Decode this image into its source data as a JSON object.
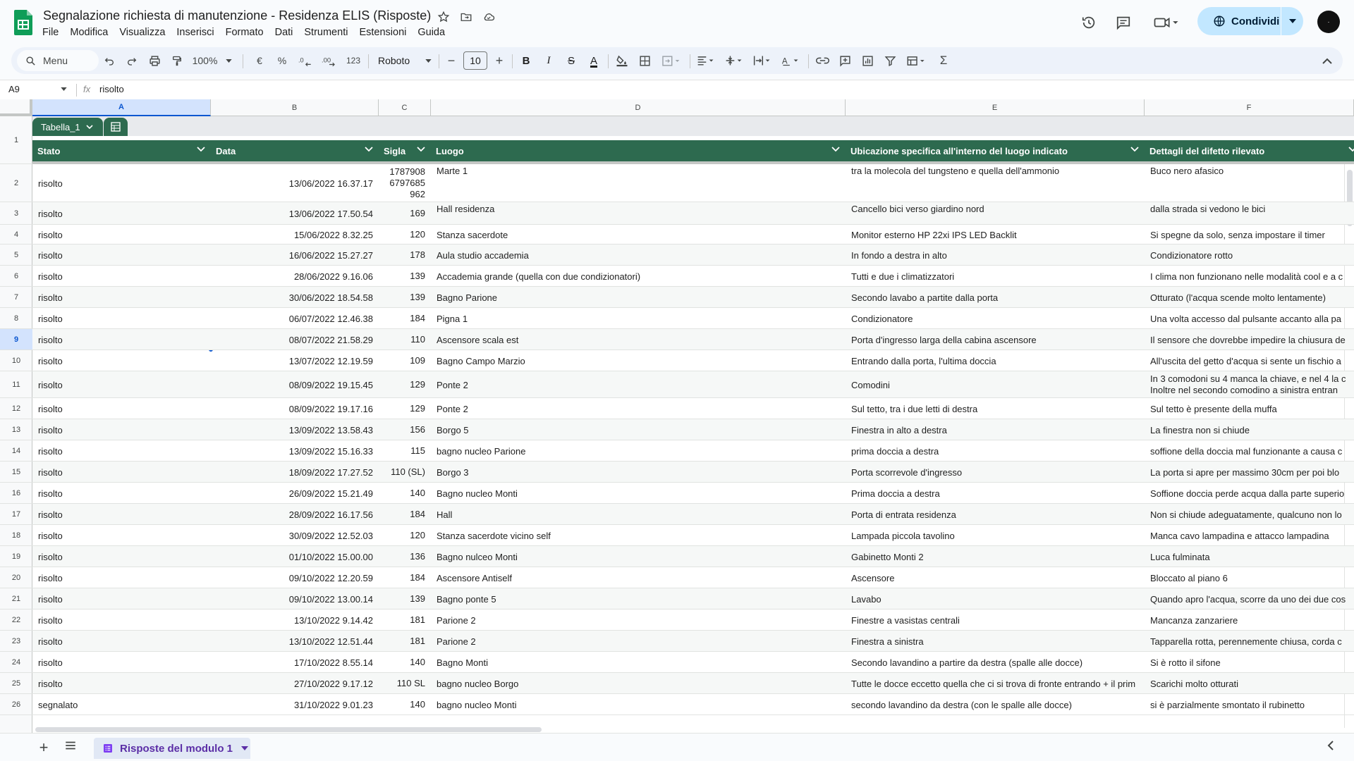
{
  "app": {
    "title": "Segnalazione richiesta di manutenzione - Residenza ELIS (Risposte)",
    "menus": [
      "File",
      "Modifica",
      "Visualizza",
      "Inserisci",
      "Formato",
      "Dati",
      "Strumenti",
      "Estensioni",
      "Guida"
    ],
    "share_label": "Condividi",
    "avatar_text": "·"
  },
  "toolbar": {
    "search_label": "Menu",
    "zoom": "100%",
    "currency": "€",
    "percent": "%",
    "dec_decrease": ".0←",
    "dec_increase": ".00",
    "number_format": "123",
    "font": "Roboto",
    "font_size": "10",
    "minus": "−",
    "plus": "+",
    "bold": "B",
    "italic": "I",
    "strike": "S",
    "text_color": "A",
    "sum": "Σ"
  },
  "formula_bar": {
    "cell_ref": "A9",
    "fx": "fx",
    "value": "risolto"
  },
  "columns": [
    "A",
    "B",
    "C",
    "D",
    "E",
    "F"
  ],
  "table": {
    "name": "Tabella_1",
    "headers": [
      "Stato",
      "Data",
      "Sigla",
      "Luogo",
      "Ubicazione specifica all'interno del luogo indicato",
      "Dettagli del difetto rilevato"
    ],
    "rows": [
      {
        "n": "2",
        "stato": "risolto",
        "data": "13/06/2022 16.37.17",
        "sigla": [
          "1787908",
          "6797685",
          "962"
        ],
        "luogo": "Marte 1",
        "ubicazione": "tra la molecola del tungsteno e quella dell'ammonio",
        "dettagli": "Buco nero afasico"
      },
      {
        "n": "3",
        "stato": "risolto",
        "data": "13/06/2022 17.50.54",
        "sigla": [
          "169"
        ],
        "luogo": "Hall residenza",
        "ubicazione": "Cancello bici verso giardino nord",
        "dettagli": "dalla strada si vedono le bici"
      },
      {
        "n": "4",
        "stato": "risolto",
        "data": "15/06/2022 8.32.25",
        "sigla": [
          "120"
        ],
        "luogo": "Stanza sacerdote",
        "ubicazione": "Monitor esterno HP 22xi IPS LED Backlit",
        "dettagli": "Si spegne da solo, senza impostare il timer"
      },
      {
        "n": "5",
        "stato": "risolto",
        "data": "16/06/2022 15.27.27",
        "sigla": [
          "178"
        ],
        "luogo": "Aula studio accademia",
        "ubicazione": "In fondo a destra in alto",
        "dettagli": "Condizionatore rotto"
      },
      {
        "n": "6",
        "stato": "risolto",
        "data": "28/06/2022 9.16.06",
        "sigla": [
          "139"
        ],
        "luogo": "Accademia grande (quella con due condizionatori)",
        "ubicazione": "Tutti e due i climatizzatori",
        "dettagli": "I clima non funzionano nelle modalità cool e a c"
      },
      {
        "n": "7",
        "stato": "risolto",
        "data": "30/06/2022 18.54.58",
        "sigla": [
          "139"
        ],
        "luogo": "Bagno Parione",
        "ubicazione": "Secondo lavabo a partite dalla porta",
        "dettagli": "Otturato (l'acqua scende molto lentamente)"
      },
      {
        "n": "8",
        "stato": "risolto",
        "data": "06/07/2022 12.46.38",
        "sigla": [
          "184"
        ],
        "luogo": "Pigna 1",
        "ubicazione": "Condizionatore",
        "dettagli": "Una volta accesso dal pulsante accanto alla pa"
      },
      {
        "n": "9",
        "stato": "risolto",
        "data": "08/07/2022 21.58.29",
        "sigla": [
          "110"
        ],
        "luogo": "Ascensore scala est",
        "ubicazione": "Porta d'ingresso larga della cabina ascensore",
        "dettagli": "Il sensore che dovrebbe impedire la chiusura de"
      },
      {
        "n": "10",
        "stato": "risolto",
        "data": "13/07/2022 12.19.59",
        "sigla": [
          "109"
        ],
        "luogo": "Bagno Campo Marzio",
        "ubicazione": "Entrando dalla porta, l'ultima doccia",
        "dettagli": "All'uscita del getto d'acqua si sente un fischio a"
      },
      {
        "n": "11",
        "stato": "risolto",
        "data": "08/09/2022 19.15.45",
        "sigla": [
          "129"
        ],
        "luogo": "Ponte 2",
        "ubicazione": "Comodini",
        "dettagli": "In 3 comodoni su 4 manca la chiave, e nel 4 la c",
        "dettagli2": "Inoltre nel secondo comodino a sinistra entran"
      },
      {
        "n": "12",
        "stato": "risolto",
        "data": "08/09/2022 19.17.16",
        "sigla": [
          "129"
        ],
        "luogo": "Ponte 2",
        "ubicazione": "Sul tetto, tra i due letti di destra",
        "dettagli": "Sul tetto è presente della muffa"
      },
      {
        "n": "13",
        "stato": "risolto",
        "data": "13/09/2022 13.58.43",
        "sigla": [
          "156"
        ],
        "luogo": "Borgo 5",
        "ubicazione": "Finestra in alto a destra",
        "dettagli": "La finestra non si chiude"
      },
      {
        "n": "14",
        "stato": "risolto",
        "data": "13/09/2022 15.16.33",
        "sigla": [
          "115"
        ],
        "luogo": "bagno nucleo Parione",
        "ubicazione": "prima doccia a destra",
        "dettagli": "soffione della doccia mal funzionante a causa c"
      },
      {
        "n": "15",
        "stato": "risolto",
        "data": "18/09/2022 17.27.52",
        "sigla": [
          "110 (SL)"
        ],
        "luogo": "Borgo 3",
        "ubicazione": "Porta scorrevole d'ingresso",
        "dettagli": "La porta si apre per massimo 30cm per poi blo"
      },
      {
        "n": "16",
        "stato": "risolto",
        "data": "26/09/2022 15.21.49",
        "sigla": [
          "140"
        ],
        "luogo": "Bagno nucleo Monti",
        "ubicazione": "Prima doccia a destra",
        "dettagli": "Soffione doccia perde acqua dalla parte superio"
      },
      {
        "n": "17",
        "stato": "risolto",
        "data": "28/09/2022 16.17.56",
        "sigla": [
          "184"
        ],
        "luogo": "Hall",
        "ubicazione": "Porta di entrata residenza",
        "dettagli": "Non si chiude adeguatamente, qualcuno non lo"
      },
      {
        "n": "18",
        "stato": "risolto",
        "data": "30/09/2022 12.52.03",
        "sigla": [
          "120"
        ],
        "luogo": "Stanza sacerdote vicino self",
        "ubicazione": "Lampada piccola tavolino",
        "dettagli": "Manca cavo lampadina e attacco lampadina"
      },
      {
        "n": "19",
        "stato": "risolto",
        "data": "01/10/2022 15.00.00",
        "sigla": [
          "136"
        ],
        "luogo": "Bagno nulceo Monti",
        "ubicazione": "Gabinetto Monti 2",
        "dettagli": "Luca fulminata"
      },
      {
        "n": "20",
        "stato": "risolto",
        "data": "09/10/2022 12.20.59",
        "sigla": [
          "184"
        ],
        "luogo": "Ascensore Antiself",
        "ubicazione": "Ascensore",
        "dettagli": "Bloccato al piano 6"
      },
      {
        "n": "21",
        "stato": "risolto",
        "data": "09/10/2022 13.00.14",
        "sigla": [
          "139"
        ],
        "luogo": "Bagno ponte 5",
        "ubicazione": "Lavabo",
        "dettagli": "Quando apro l'acqua, scorre da uno dei due cos"
      },
      {
        "n": "22",
        "stato": "risolto",
        "data": "13/10/2022 9.14.42",
        "sigla": [
          "181"
        ],
        "luogo": "Parione 2",
        "ubicazione": "Finestre a vasistas centrali",
        "dettagli": "Mancanza zanzariere"
      },
      {
        "n": "23",
        "stato": "risolto",
        "data": "13/10/2022 12.51.44",
        "sigla": [
          "181"
        ],
        "luogo": "Parione 2",
        "ubicazione": "Finestra a sinistra",
        "dettagli": "Tapparella rotta, perennemente chiusa, corda c"
      },
      {
        "n": "24",
        "stato": "risolto",
        "data": "17/10/2022 8.55.14",
        "sigla": [
          "140"
        ],
        "luogo": "Bagno Monti",
        "ubicazione": "Secondo lavandino a partire da destra (spalle alle docce)",
        "dettagli": "Si è rotto il sifone"
      },
      {
        "n": "25",
        "stato": "risolto",
        "data": "27/10/2022 9.17.12",
        "sigla": [
          "110 SL"
        ],
        "luogo": "bagno nucleo Borgo",
        "ubicazione": "Tutte le docce eccetto quella che ci si trova di fronte entrando + il prim",
        "dettagli": "Scarichi molto otturati"
      },
      {
        "n": "26",
        "stato": "segnalato",
        "data": "31/10/2022 9.01.23",
        "sigla": [
          "140"
        ],
        "luogo": "bagno nucleo Monti",
        "ubicazione": "secondo lavandino da destra (con le spalle alle docce)",
        "dettagli": "si è parzialmente smontato il rubinetto"
      }
    ]
  },
  "sheet_tab": {
    "label": "Risposte del modulo 1"
  },
  "colors": {
    "table_header": "#2d6a4f",
    "selection": "#0b57d0",
    "share_bg": "#c2e7ff",
    "sheet_tab_text": "#5b2ea6"
  }
}
